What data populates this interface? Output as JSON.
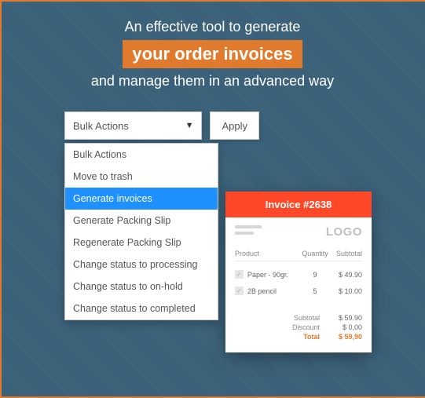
{
  "headline": {
    "line1": "An effective tool to generate",
    "highlight": "your order invoices",
    "line3": "and manage them in an advanced way"
  },
  "bulk": {
    "selected_label": "Bulk Actions",
    "apply_label": "Apply",
    "options": [
      "Bulk Actions",
      "Move to trash",
      "Generate invoices",
      "Generate Packing Slip",
      "Regenerate Packing Slip",
      "Change status to processing",
      "Change status to on-hold",
      "Change status to completed"
    ],
    "highlighted_index": 2
  },
  "invoice": {
    "title": "Invoice #2638",
    "logo_text": "LOGO",
    "columns": {
      "product": "Product",
      "quantity": "Quantity",
      "subtotal": "Subtotal"
    },
    "rows": [
      {
        "product": "Paper - 90gr.",
        "qty": "9",
        "subtotal": "$ 49.90"
      },
      {
        "product": "2B pencil",
        "qty": "5",
        "subtotal": "$ 10.00"
      }
    ],
    "totals": {
      "subtotal_label": "Subtotal",
      "subtotal_value": "$ 59.90",
      "discount_label": "Discount",
      "discount_value": "$ 0,00",
      "total_label": "Total",
      "total_value": "$ 59,90"
    }
  }
}
